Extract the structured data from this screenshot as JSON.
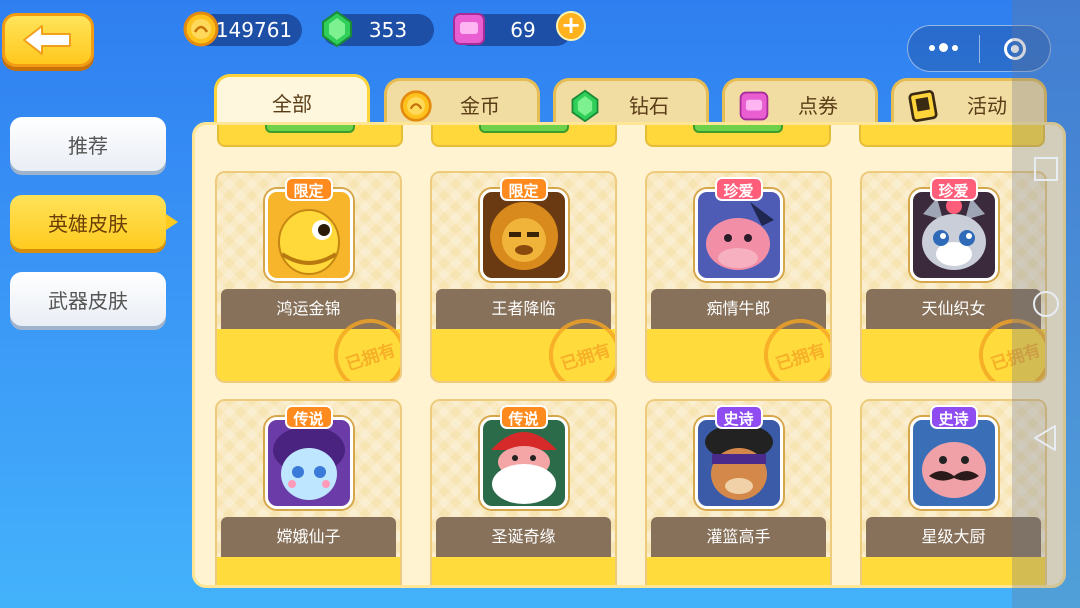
{
  "topbar": {
    "back_icon": "arrow-left-icon",
    "coins": {
      "value": "149761",
      "icon": "coin-icon",
      "color": "#ffc21d"
    },
    "gems": {
      "value": "353",
      "icon": "green-gem-icon",
      "color": "#2fcf5a"
    },
    "tickets": {
      "value": "69",
      "icon": "pink-ticket-icon",
      "color": "#e95fd2"
    },
    "plus_label": "+",
    "capsule": {
      "menu_icon": "more-dots-icon",
      "close_icon": "target-close-icon"
    }
  },
  "sidebar": {
    "items": [
      {
        "label": "推荐",
        "active": false
      },
      {
        "label": "英雄皮肤",
        "active": true
      },
      {
        "label": "武器皮肤",
        "active": false
      }
    ]
  },
  "tabs": [
    {
      "label": "全部",
      "icon": "",
      "active": true
    },
    {
      "label": "金币",
      "icon": "coin-icon",
      "active": false
    },
    {
      "label": "钻石",
      "icon": "green-gem-icon",
      "active": false
    },
    {
      "label": "点券",
      "icon": "pink-ticket-icon",
      "active": false
    },
    {
      "label": "活动",
      "icon": "event-ticket-icon",
      "active": false
    }
  ],
  "cards": [
    {
      "name": "鸿运金锦",
      "rarity": "限定",
      "rarity_color": "#ff8a1d",
      "owned": "已拥有",
      "theme": "gold-fish"
    },
    {
      "name": "王者降临",
      "rarity": "限定",
      "rarity_color": "#ff8a1d",
      "owned": "已拥有",
      "theme": "golden-lion"
    },
    {
      "name": "痴情牛郎",
      "rarity": "珍爱",
      "rarity_color": "#ff5e7a",
      "owned": "已拥有",
      "theme": "pink-hippo"
    },
    {
      "name": "天仙织女",
      "rarity": "珍爱",
      "rarity_color": "#ff5e7a",
      "owned": "已拥有",
      "theme": "grey-cat"
    },
    {
      "name": "嫦娥仙子",
      "rarity": "传说",
      "rarity_color": "#ff8a1d",
      "owned": "",
      "theme": "purple-fairy"
    },
    {
      "name": "圣诞奇缘",
      "rarity": "传说",
      "rarity_color": "#ff8a1d",
      "owned": "",
      "theme": "santa-pig"
    },
    {
      "name": "灌篮高手",
      "rarity": "史诗",
      "rarity_color": "#8f4cf0",
      "owned": "",
      "theme": "dog-ninja"
    },
    {
      "name": "星级大厨",
      "rarity": "史诗",
      "rarity_color": "#8f4cf0",
      "owned": "",
      "theme": "mustache-pig"
    }
  ],
  "system_nav": {
    "recent_icon": "square-icon",
    "home_icon": "circle-icon",
    "back_icon": "triangle-back-icon"
  }
}
